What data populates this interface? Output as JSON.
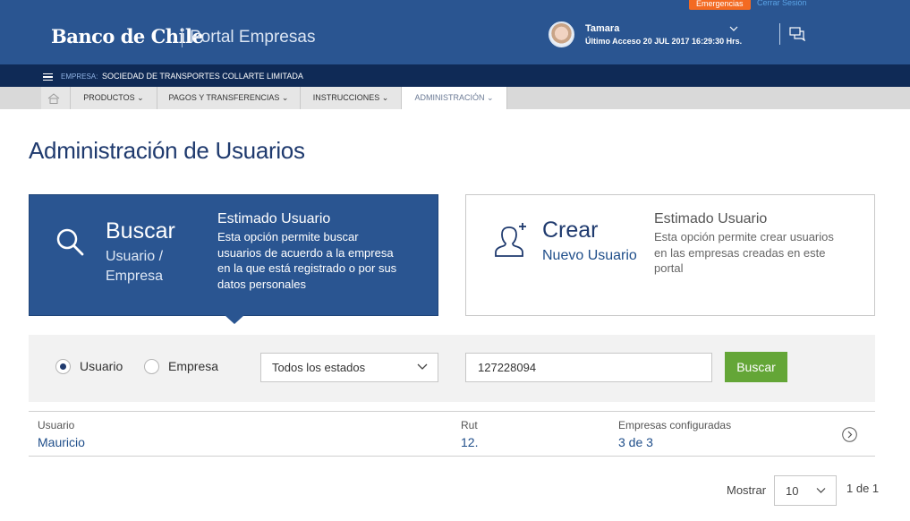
{
  "header": {
    "logo_text": "Banco de Chile",
    "portal_name": "Portal Empresas",
    "emergencias_label": "Emergencias",
    "cerrar_sesion_label": "Cerrar Sesión",
    "user_name": "Tamara",
    "last_access": "Último Acceso 20 JUL 2017 16:29:30 Hrs."
  },
  "company_bar": {
    "label": "EMPRESA:",
    "name": "SOCIEDAD DE TRANSPORTES COLLARTE LIMITADA"
  },
  "nav": {
    "items": [
      {
        "label": "PRODUCTOS"
      },
      {
        "label": "PAGOS Y TRANSFERENCIAS"
      },
      {
        "label": "INSTRUCCIONES"
      },
      {
        "label": "ADMINISTRACIÓN"
      }
    ],
    "active_index": 3
  },
  "page": {
    "title": "Administración de Usuarios"
  },
  "cards": {
    "search": {
      "title": "Buscar",
      "subtitle_line1": "Usuario /",
      "subtitle_line2": "Empresa",
      "heading": "Estimado Usuario",
      "desc_lines": [
        "Esta opción permite buscar",
        "usuarios de acuerdo a la empresa",
        "en la que está registrado o por sus",
        "datos personales"
      ]
    },
    "create": {
      "title": "Crear",
      "subtitle": "Nuevo Usuario",
      "heading": "Estimado Usuario",
      "desc_lines": [
        "Esta opción permite crear usuarios",
        "en las empresas creadas en este",
        "portal"
      ]
    }
  },
  "filter": {
    "radio_usuario": "Usuario",
    "radio_empresa": "Empresa",
    "selected": "Usuario",
    "status_select": "Todos los estados",
    "rut_value": "127228094",
    "search_button": "Buscar"
  },
  "results": {
    "columns": [
      "Usuario",
      "Rut",
      "Empresas configuradas"
    ],
    "rows": [
      {
        "usuario": "Mauricio",
        "rut": "12.",
        "empresas": "3 de 3"
      }
    ]
  },
  "pagination": {
    "show_label": "Mostrar",
    "page_size": "10",
    "page_info": "1 de 1"
  },
  "colors": {
    "header_bg": "#2a5591",
    "company_bar_bg": "#0f2a56",
    "accent_orange": "#f36a22",
    "button_green": "#64a637",
    "title_blue": "#1f3a6e"
  }
}
